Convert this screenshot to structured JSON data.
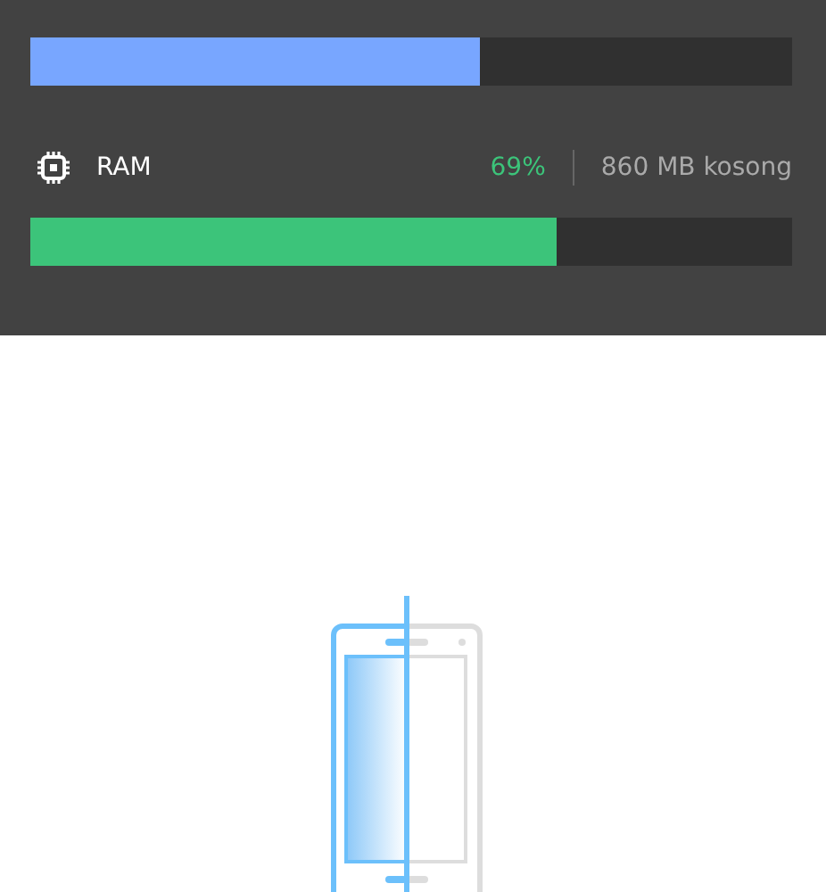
{
  "bars": [
    {
      "level": 0.59,
      "color": "#78a6ff"
    }
  ],
  "ram": {
    "label": "RAM",
    "percent": "69%",
    "free": "860 MB kosong",
    "level": 0.69,
    "color": "#3cc47a"
  }
}
